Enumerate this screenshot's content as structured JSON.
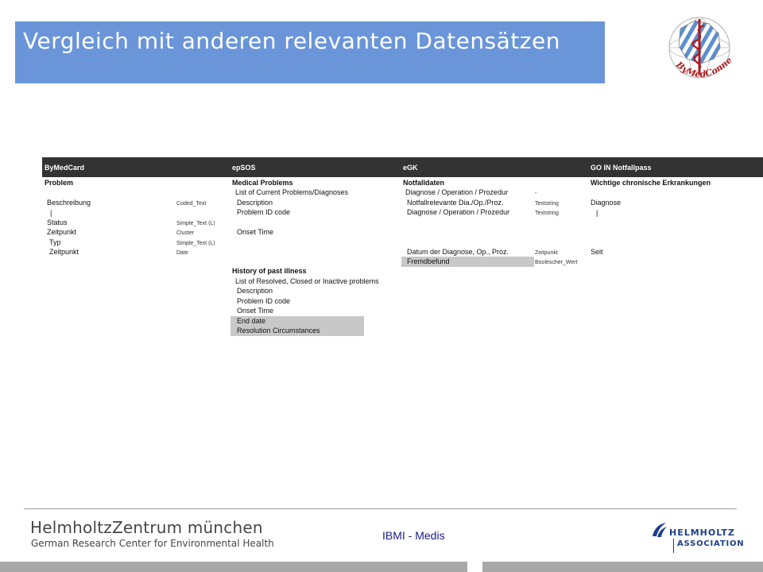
{
  "slide": {
    "title": "Vergleich mit anderen relevanten Datensätzen"
  },
  "logo": {
    "text": "ByMedConnect"
  },
  "table": {
    "headers": [
      "ByMedCard",
      "epSOS",
      "eGK",
      "GO IN Notfallpass"
    ],
    "bymedcard": [
      {
        "label": "Problem",
        "type": ""
      },
      {
        "label": "Beschreibung",
        "type": "Coded_Text"
      },
      {
        "label": "|",
        "type": ""
      },
      {
        "label": "Status",
        "type": "Simple_Text (L)"
      },
      {
        "label": "Zeitpunkt",
        "type": "Cluster"
      },
      {
        "label": "Typ",
        "type": "Simple_Text (L)"
      },
      {
        "label": "Zeitpunkt",
        "type": "Date"
      }
    ],
    "epsos": [
      "Medical Problems",
      "List of Current Problems/Diagnoses",
      "Description",
      "Problem ID code",
      "Onset Time",
      "History of past illness",
      "List of Resolved, Closed or Inactive problems",
      "Description",
      "Problem ID code",
      "Onset Time",
      "End date",
      "Resolution Circumstances"
    ],
    "egk": [
      {
        "label": "Notfalldaten",
        "type": ""
      },
      {
        "label": "Diagnose / Operation / Prozedur",
        "type": "-"
      },
      {
        "label": "Notfallrelevante Dia./Op./Proz.",
        "type": "Textstring"
      },
      {
        "label": "Diagnose / Operation / Prozedur",
        "type": "Textstring"
      },
      {
        "label": "Datum der Diagnose, Op., Proz.",
        "type": "Zeitpunkt"
      },
      {
        "label": "Fremdbefund",
        "type": "Boolescher_Wert"
      }
    ],
    "goin": [
      "Wichtige chronische Erkrankungen",
      "Diagnose",
      "|",
      "Seit"
    ]
  },
  "footer": {
    "org_name": "HelmholtzZentrum münchen",
    "org_subtitle": "German Research Center for Environmental Health",
    "center_label": "IBMI - Medis",
    "association_line1": "HELMHOLTZ",
    "association_line2": "ASSOCIATION"
  },
  "colors": {
    "title_bg": "#6a95d9",
    "table_header_bg": "#333333",
    "highlight": "#c8c8c8",
    "association_blue": "#1c3f8a"
  }
}
